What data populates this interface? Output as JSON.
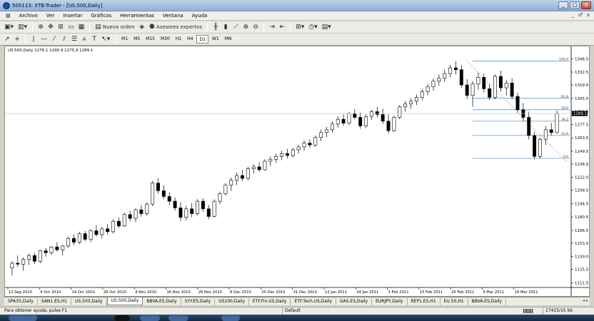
{
  "window": {
    "title": "505113: XTB-Trader - [US.500,Daily]",
    "controls": [
      "_",
      "□",
      "X"
    ]
  },
  "menu": [
    "Archivo",
    "Ver",
    "Insertar",
    "Gráficos",
    "Herramientas",
    "Ventana",
    "Ayuda"
  ],
  "mdi_controls": [
    "_",
    "♂",
    "x"
  ],
  "toolbar1": {
    "new_order": "Nueva orden",
    "expert_advisors": "Asesores expertos"
  },
  "toolbar2": {
    "text_tool": "A",
    "timeframes": [
      "M1",
      "M5",
      "M15",
      "M30",
      "H1",
      "H4",
      "D1",
      "W1",
      "MN"
    ],
    "active_timeframe": "D1"
  },
  "chart": {
    "symbol_info": "US.500,Daily  1276.1 1290.9 1275.9 1289.1",
    "current_price_label": "1289.1",
    "colors": {
      "candle": "#000000",
      "fib": "#5b9bd5",
      "price_line": "#bdbdbd",
      "trend": "#9e9e9e"
    }
  },
  "chart_data": {
    "type": "candlestick",
    "title": "",
    "y_ticks": [
      1346.5,
      1332.5,
      1319.0,
      1305.0,
      1291.5,
      1277.5,
      1263.5,
      1249.5,
      1236.0,
      1222.0,
      1208.5,
      1194.5,
      1180.5,
      1166.5,
      1153.0,
      1139.0,
      1125.5,
      1111.5
    ],
    "ylim": [
      1108,
      1352
    ],
    "x_ticks": [
      "12 Sep 2010",
      "4 Oct 2010",
      "14 Oct 2010",
      "26 Oct 2010",
      "4 Nov 2010",
      "16 Nov 2010",
      "26 Nov 2010",
      "8 Dec 2010",
      "20 Dec 2010",
      "31 Dec 2010",
      "12 Jan 2011",
      "24 Jan 2011",
      "3 Feb 2011",
      "15 Feb 2011",
      "25 Feb 2011",
      "9 Mar 2011",
      "18 Mar 2011"
    ],
    "fibonacci_levels": [
      {
        "label": "100.0",
        "value": 1344.0
      },
      {
        "label": "61.8",
        "value": 1305.0
      },
      {
        "label": "50.0",
        "value": 1293.0
      },
      {
        "label": "38.2",
        "value": 1281.0
      },
      {
        "label": "23.6",
        "value": 1266.0
      },
      {
        "label": "0.0",
        "value": 1242.0
      }
    ],
    "candles": [
      [
        1127,
        1134,
        1119,
        1132
      ],
      [
        1132,
        1140,
        1128,
        1131
      ],
      [
        1131,
        1138,
        1124,
        1136
      ],
      [
        1136,
        1142,
        1130,
        1140
      ],
      [
        1140,
        1143,
        1131,
        1134
      ],
      [
        1134,
        1146,
        1132,
        1145
      ],
      [
        1145,
        1148,
        1139,
        1143
      ],
      [
        1143,
        1150,
        1141,
        1149
      ],
      [
        1149,
        1154,
        1144,
        1146
      ],
      [
        1146,
        1151,
        1140,
        1150
      ],
      [
        1150,
        1160,
        1148,
        1158
      ],
      [
        1158,
        1162,
        1151,
        1154
      ],
      [
        1154,
        1165,
        1152,
        1163
      ],
      [
        1163,
        1166,
        1155,
        1157
      ],
      [
        1157,
        1168,
        1154,
        1166
      ],
      [
        1166,
        1172,
        1160,
        1162
      ],
      [
        1162,
        1170,
        1158,
        1168
      ],
      [
        1168,
        1173,
        1162,
        1165
      ],
      [
        1165,
        1178,
        1163,
        1176
      ],
      [
        1176,
        1180,
        1169,
        1171
      ],
      [
        1171,
        1185,
        1170,
        1183
      ],
      [
        1183,
        1187,
        1176,
        1179
      ],
      [
        1179,
        1190,
        1175,
        1188
      ],
      [
        1188,
        1193,
        1181,
        1184
      ],
      [
        1184,
        1196,
        1182,
        1194
      ],
      [
        1194,
        1218,
        1192,
        1216
      ],
      [
        1216,
        1221,
        1205,
        1208
      ],
      [
        1208,
        1214,
        1199,
        1202
      ],
      [
        1202,
        1206,
        1193,
        1197
      ],
      [
        1197,
        1201,
        1187,
        1190
      ],
      [
        1190,
        1196,
        1176,
        1180
      ],
      [
        1180,
        1192,
        1177,
        1189
      ],
      [
        1189,
        1195,
        1180,
        1184
      ],
      [
        1184,
        1199,
        1182,
        1197
      ],
      [
        1197,
        1200,
        1186,
        1189
      ],
      [
        1189,
        1193,
        1178,
        1181
      ],
      [
        1181,
        1199,
        1180,
        1197
      ],
      [
        1197,
        1207,
        1194,
        1205
      ],
      [
        1205,
        1216,
        1203,
        1214
      ],
      [
        1214,
        1222,
        1208,
        1219
      ],
      [
        1219,
        1227,
        1214,
        1224
      ],
      [
        1224,
        1230,
        1218,
        1221
      ],
      [
        1221,
        1233,
        1219,
        1231
      ],
      [
        1231,
        1236,
        1226,
        1233
      ],
      [
        1233,
        1238,
        1228,
        1230
      ],
      [
        1230,
        1241,
        1229,
        1239
      ],
      [
        1239,
        1244,
        1234,
        1241
      ],
      [
        1241,
        1247,
        1237,
        1244
      ],
      [
        1244,
        1250,
        1240,
        1247
      ],
      [
        1247,
        1252,
        1242,
        1245
      ],
      [
        1245,
        1253,
        1243,
        1251
      ],
      [
        1251,
        1256,
        1247,
        1254
      ],
      [
        1254,
        1261,
        1250,
        1258
      ],
      [
        1258,
        1262,
        1253,
        1256
      ],
      [
        1256,
        1266,
        1254,
        1264
      ],
      [
        1264,
        1272,
        1260,
        1269
      ],
      [
        1269,
        1275,
        1264,
        1272
      ],
      [
        1272,
        1281,
        1269,
        1278
      ],
      [
        1278,
        1286,
        1274,
        1283
      ],
      [
        1283,
        1288,
        1276,
        1279
      ],
      [
        1279,
        1291,
        1277,
        1289
      ],
      [
        1289,
        1294,
        1283,
        1285
      ],
      [
        1285,
        1290,
        1273,
        1276
      ],
      [
        1276,
        1288,
        1274,
        1286
      ],
      [
        1286,
        1293,
        1282,
        1291
      ],
      [
        1291,
        1296,
        1285,
        1288
      ],
      [
        1288,
        1294,
        1278,
        1281
      ],
      [
        1281,
        1288,
        1268,
        1271
      ],
      [
        1271,
        1287,
        1270,
        1285
      ],
      [
        1285,
        1298,
        1283,
        1296
      ],
      [
        1296,
        1302,
        1291,
        1299
      ],
      [
        1299,
        1305,
        1294,
        1302
      ],
      [
        1302,
        1309,
        1298,
        1306
      ],
      [
        1306,
        1315,
        1303,
        1312
      ],
      [
        1312,
        1320,
        1308,
        1317
      ],
      [
        1317,
        1326,
        1313,
        1323
      ],
      [
        1323,
        1330,
        1318,
        1326
      ],
      [
        1326,
        1335,
        1322,
        1331
      ],
      [
        1331,
        1340,
        1327,
        1337
      ],
      [
        1337,
        1344,
        1330,
        1335
      ],
      [
        1335,
        1340,
        1316,
        1319
      ],
      [
        1319,
        1325,
        1304,
        1308
      ],
      [
        1308,
        1323,
        1296,
        1320
      ],
      [
        1320,
        1332,
        1314,
        1327
      ],
      [
        1327,
        1331,
        1311,
        1315
      ],
      [
        1315,
        1320,
        1303,
        1306
      ],
      [
        1306,
        1330,
        1304,
        1328
      ],
      [
        1328,
        1334,
        1312,
        1316
      ],
      [
        1316,
        1324,
        1308,
        1321
      ],
      [
        1321,
        1326,
        1304,
        1307
      ],
      [
        1307,
        1311,
        1290,
        1293
      ],
      [
        1293,
        1300,
        1281,
        1285
      ],
      [
        1285,
        1291,
        1262,
        1266
      ],
      [
        1266,
        1270,
        1241,
        1244
      ],
      [
        1244,
        1264,
        1242,
        1262
      ],
      [
        1262,
        1276,
        1256,
        1272
      ],
      [
        1272,
        1279,
        1266,
        1269
      ],
      [
        1269,
        1292,
        1268,
        1289
      ]
    ]
  },
  "tabs": [
    "SPA35,Daily",
    "SAN1.ES,H1",
    "US.500,Daily",
    "US.500,Daily",
    "BBVA.ES,Daily",
    "SYY.ES,Daily",
    "US100,Daily",
    "ETF.Fin.US,Daily",
    "ETF.Tech.US,Daily",
    "GAS.ES,Daily",
    "EURJPY,Daily",
    "REP1.ES,H1",
    "EU.50,H1",
    "BBVA.ES,Daily"
  ],
  "active_tab_index": 3,
  "tab_scroll": "◂ ▸",
  "status": {
    "help": "Para obtener ayuda, pulse F1",
    "profile": "Default",
    "traffic": "17415/15 kb"
  }
}
